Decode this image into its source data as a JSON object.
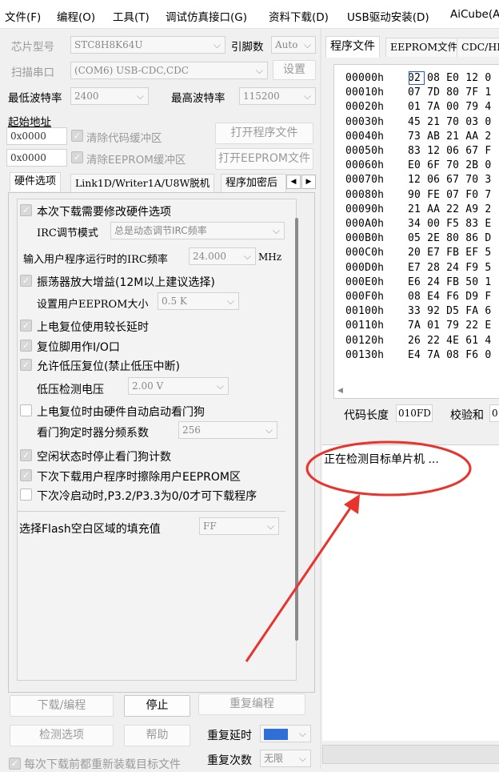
{
  "menu": [
    "文件(F)",
    "编程(O)",
    "工具(T)",
    "调试仿真接口(G)",
    "资料下载(D)",
    "USB驱动安装(D)",
    "AiCube(A"
  ],
  "chip": {
    "label": "芯片型号",
    "value": "STC8H8K64U",
    "pin_label": "引脚数",
    "pin_value": "Auto"
  },
  "port": {
    "label": "扫描串口",
    "value": "(COM6) USB-CDC,CDC",
    "settings": "设置"
  },
  "baud": {
    "min_label": "最低波特率",
    "min_value": "2400",
    "max_label": "最高波特率",
    "max_value": "115200"
  },
  "start_addr": {
    "label": "起始地址",
    "code_addr": "0x0000",
    "eeprom_addr": "0x0000",
    "clear_code": "清除代码缓冲区",
    "clear_eeprom": "清除EEPROM缓冲区",
    "open_prog": "打开程序文件",
    "open_eeprom": "打开EEPROM文件"
  },
  "left_tabs": [
    "硬件选项",
    "Link1D/Writer1A/U8W脱机",
    "程序加密后"
  ],
  "hw": {
    "modify_hw": "本次下载需要修改硬件选项",
    "irc_mode_label": "IRC调节模式",
    "irc_mode_value": "总是动态调节IRC频率",
    "irc_freq_label": "输入用户程序运行时的IRC频率",
    "irc_freq_value": "24.000",
    "irc_freq_unit": "MHz",
    "osc_gain": "振荡器放大增益(12M以上建议选择)",
    "eeprom_size_label": "设置用户EEPROM大小",
    "eeprom_size_value": "0.5 K",
    "long_delay": "上电复位使用较长延时",
    "reset_io": "复位脚用作I/O口",
    "lvr": "允许低压复位(禁止低压中断)",
    "lv_label": "低压检测电压",
    "lv_value": "2.00 V",
    "wdt_auto": "上电复位时由硬件自动启动看门狗",
    "wdt_div_label": "看门狗定时器分频系数",
    "wdt_div_value": "256",
    "idle_wdt": "空闲状态时停止看门狗计数",
    "erase_eeprom": "下次下载用户程序时擦除用户EEPROM区",
    "cold_boot": "下次冷启动时,P3.2/P3.3为0/0才可下载程序",
    "fill_label": "选择Flash空白区域的填充值",
    "fill_value": "FF"
  },
  "bottom": {
    "download": "下载/编程",
    "stop": "停止",
    "reprog": "重复编程",
    "detect": "检测选项",
    "help": "帮助",
    "repeat_delay_label": "重复延时",
    "repeat_delay_value": "",
    "repeat_count_label": "重复次数",
    "repeat_count_value": "无限",
    "reload": "每次下载前都重新装载目标文件"
  },
  "right_tabs": [
    "程序文件",
    "EEPROM文件",
    "CDC/HI"
  ],
  "hex": [
    {
      "addr": "00000h",
      "bytes": "02 08 E0 12 0"
    },
    {
      "addr": "00010h",
      "bytes": "07 7D 80 7F 1"
    },
    {
      "addr": "00020h",
      "bytes": "01 7A 00 79 4"
    },
    {
      "addr": "00030h",
      "bytes": "45 21 70 03 0"
    },
    {
      "addr": "00040h",
      "bytes": "73 AB 21 AA 2"
    },
    {
      "addr": "00050h",
      "bytes": "83 12 06 67 F"
    },
    {
      "addr": "00060h",
      "bytes": "E0 6F 70 2B 0"
    },
    {
      "addr": "00070h",
      "bytes": "12 06 67 70 3"
    },
    {
      "addr": "00080h",
      "bytes": "90 FE 07 F0 7"
    },
    {
      "addr": "00090h",
      "bytes": "21 AA 22 A9 2"
    },
    {
      "addr": "000A0h",
      "bytes": "34 00 F5 83 E"
    },
    {
      "addr": "000B0h",
      "bytes": "05 2E 80 86 D"
    },
    {
      "addr": "000C0h",
      "bytes": "20 E7 FB EF 5"
    },
    {
      "addr": "000D0h",
      "bytes": "E7 28 24 F9 5"
    },
    {
      "addr": "000E0h",
      "bytes": "E6 24 FB 50 1"
    },
    {
      "addr": "000F0h",
      "bytes": "08 E4 F6 D9 F"
    },
    {
      "addr": "00100h",
      "bytes": "33 92 D5 FA 6"
    },
    {
      "addr": "00110h",
      "bytes": "7A 01 79 22 E"
    },
    {
      "addr": "00120h",
      "bytes": "26 22 4E 61 4"
    },
    {
      "addr": "00130h",
      "bytes": "E4 7A 08 F6 0"
    }
  ],
  "code_len": {
    "label": "代码长度",
    "value": "010FD",
    "checksum_label": "校验和",
    "checksum_value": "0"
  },
  "log": "正在检测目标单片机 ..."
}
